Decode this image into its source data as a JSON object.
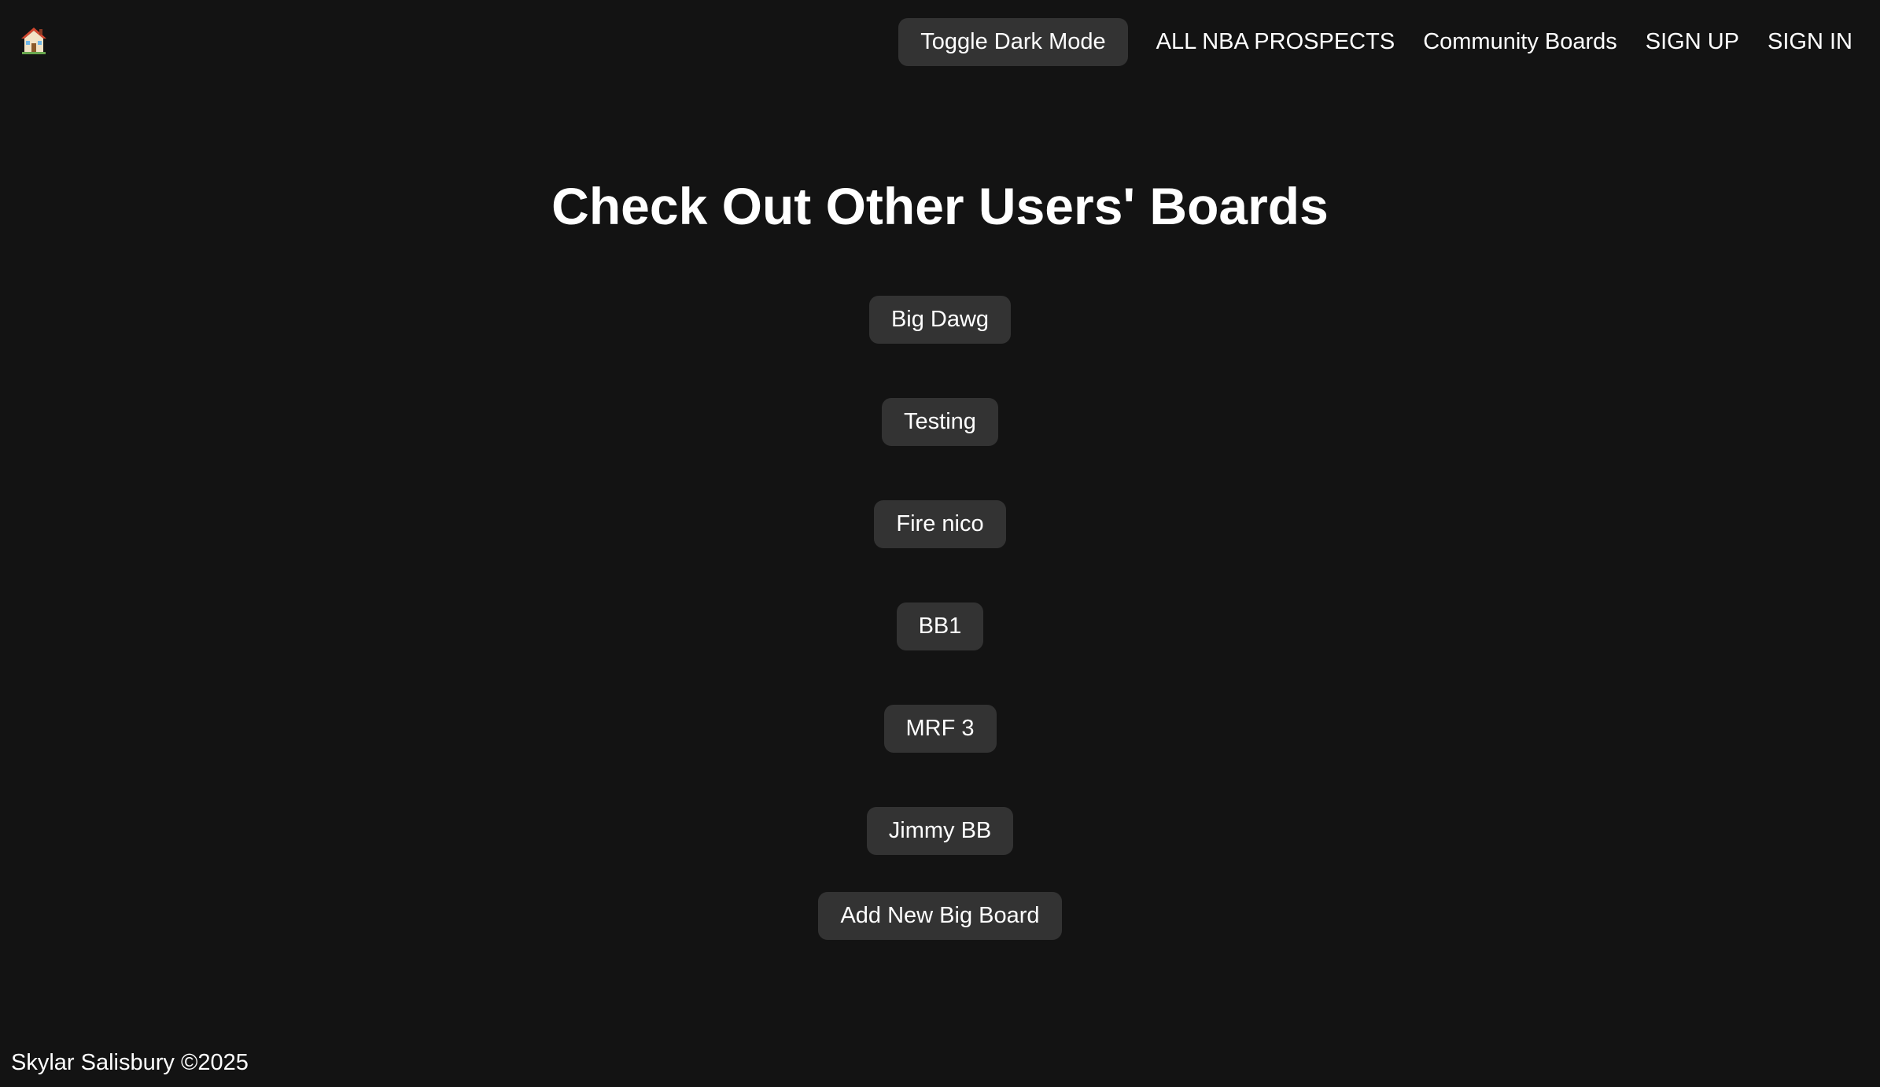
{
  "nav": {
    "home_icon": "house-icon",
    "toggle_dark_mode": "Toggle Dark Mode",
    "links": [
      "ALL NBA PROSPECTS",
      "Community Boards",
      "SIGN UP",
      "SIGN IN"
    ]
  },
  "main": {
    "title": "Check Out Other Users' Boards",
    "boards": [
      "Big Dawg",
      "Testing",
      "Fire nico",
      "BB1",
      "MRF 3",
      "Jimmy BB"
    ],
    "add_button": "Add New Big Board"
  },
  "footer": {
    "text": "Skylar Salisbury ©2025"
  },
  "colors": {
    "background": "#131313",
    "button": "#333333",
    "text": "#ffffff"
  }
}
